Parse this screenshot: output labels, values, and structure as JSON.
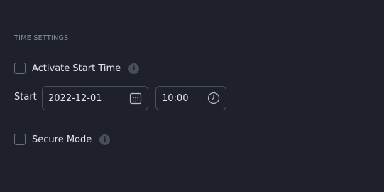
{
  "section": {
    "title": "TIME SETTINGS"
  },
  "activate_start_time": {
    "label": "Activate Start Time",
    "checked": false,
    "info_icon": "info-icon"
  },
  "start": {
    "label": "Start",
    "date_value": "2022-12-01",
    "date_icon": "calendar-icon",
    "time_value": "10:00",
    "time_icon": "clock-icon"
  },
  "secure_mode": {
    "label": "Secure Mode",
    "checked": false,
    "info_icon": "info-icon"
  },
  "colors": {
    "background": "#1e212b",
    "border": "#4a4e58",
    "text": "#e4e6eb",
    "muted": "#8b8f99"
  }
}
